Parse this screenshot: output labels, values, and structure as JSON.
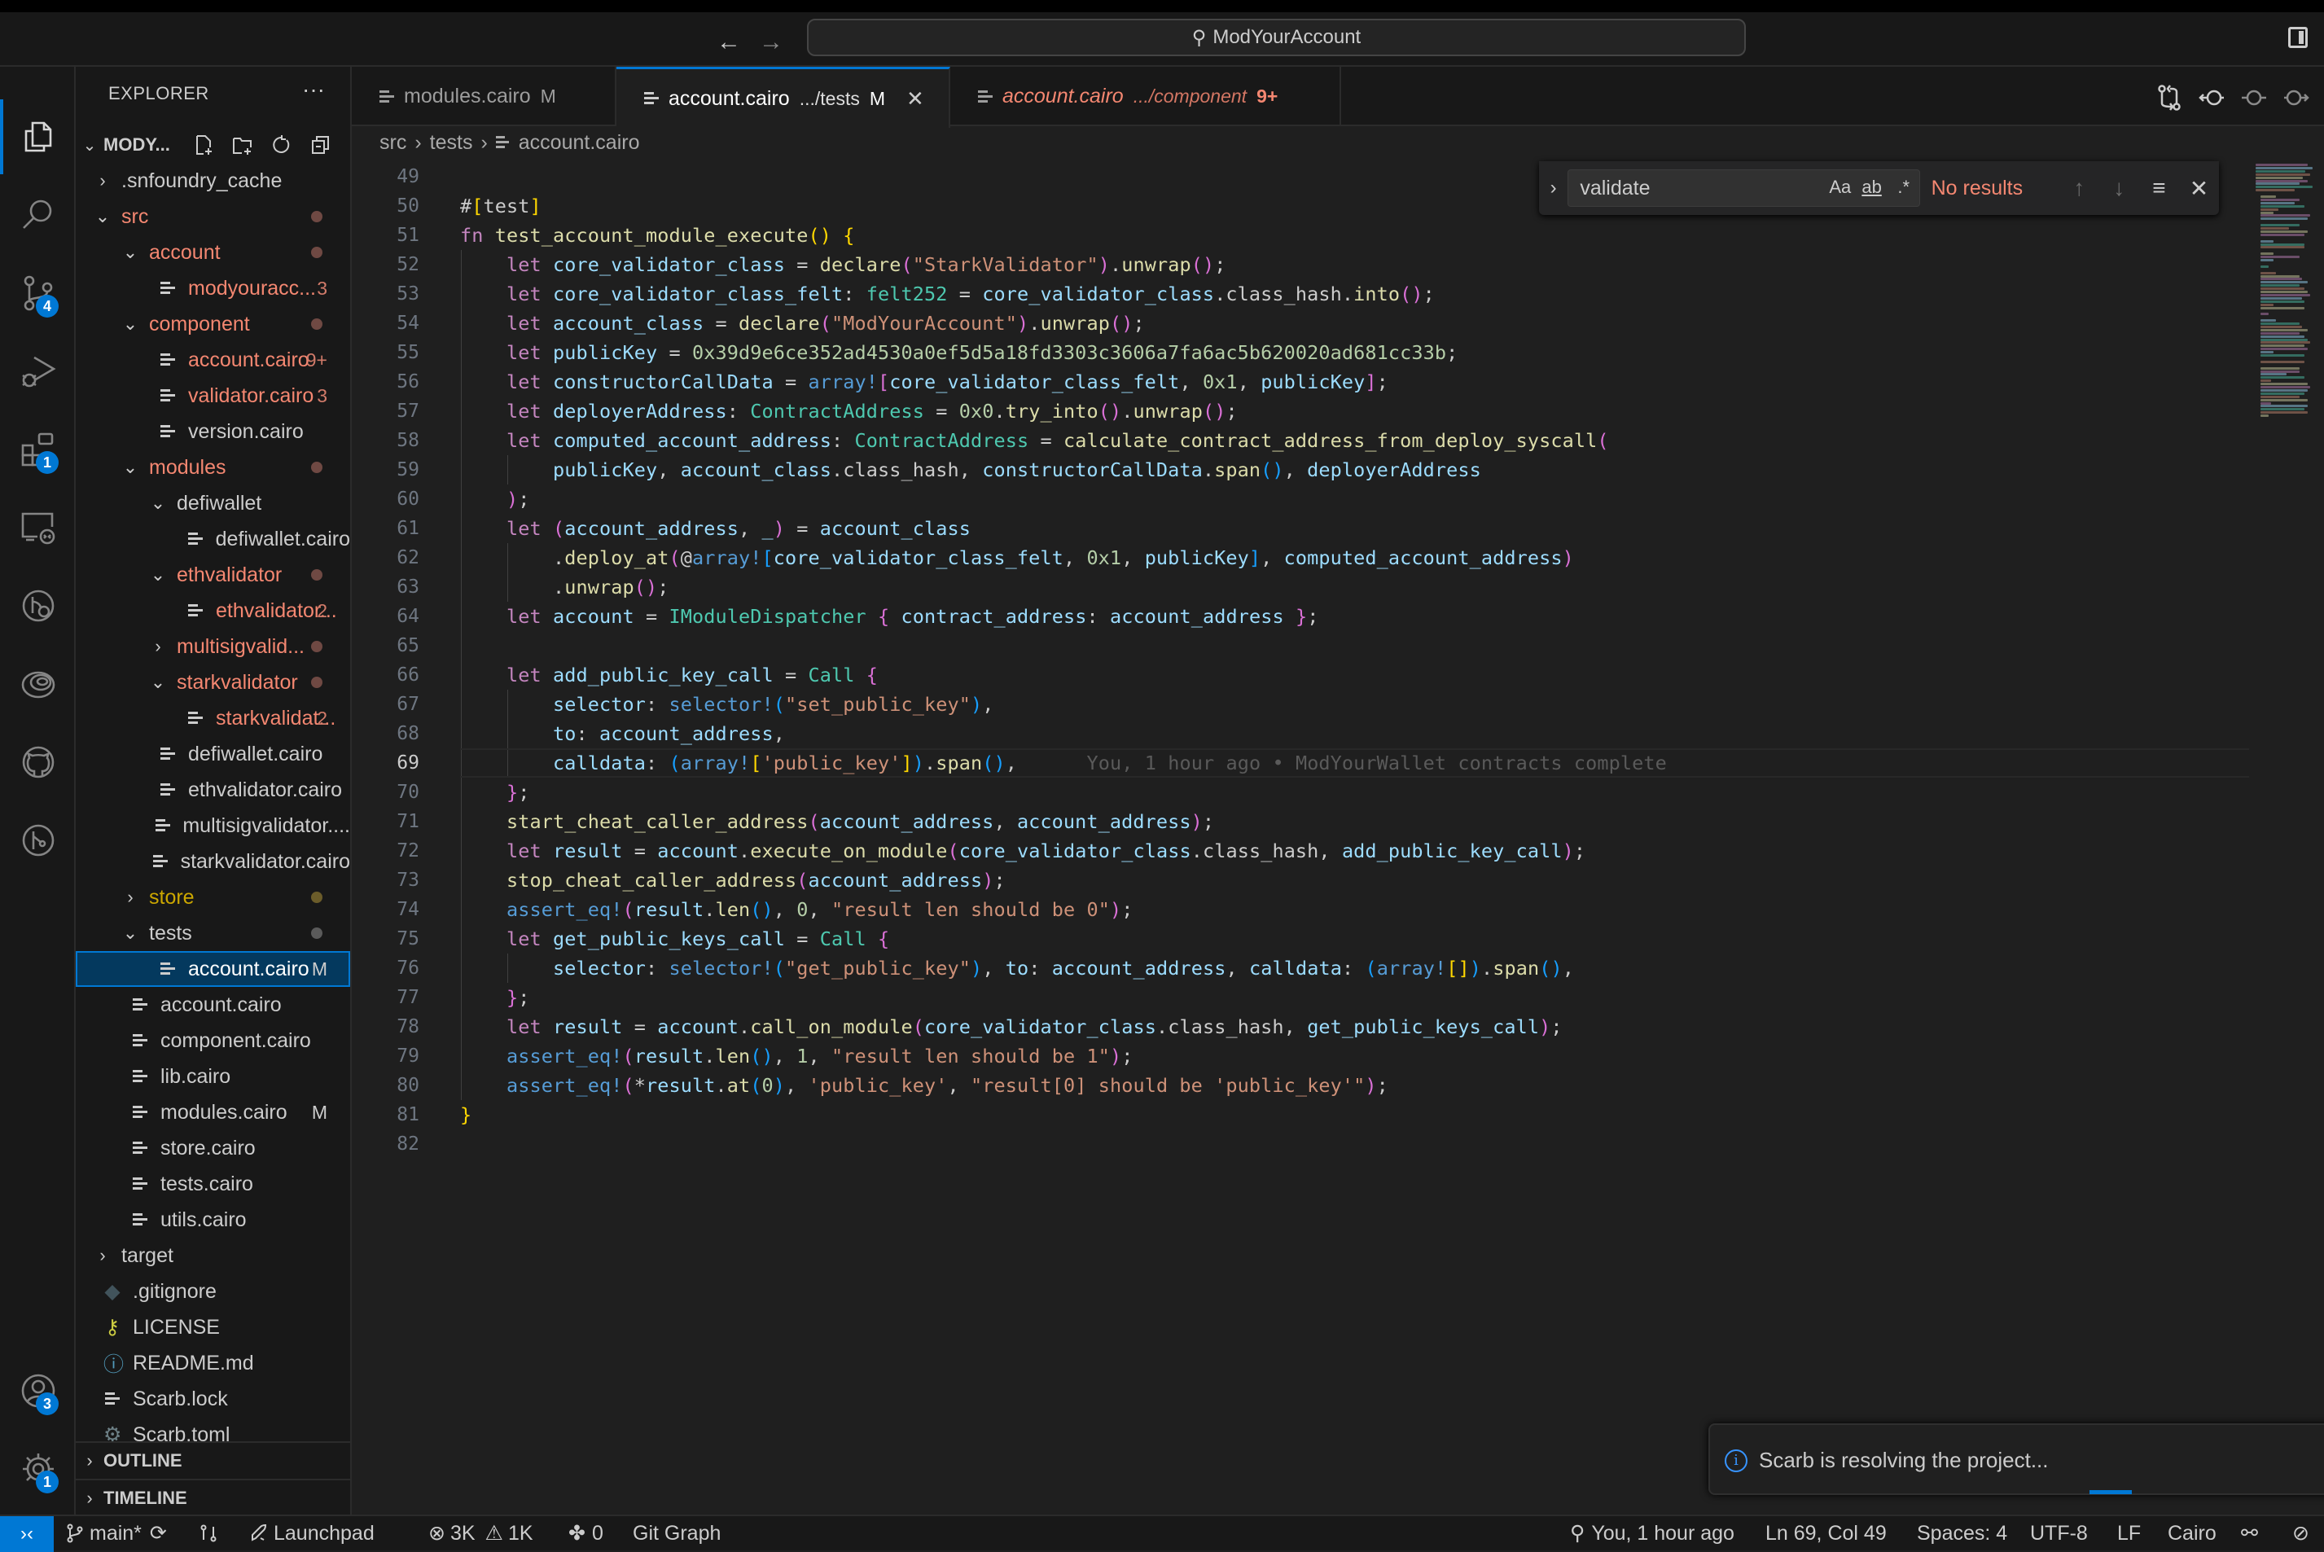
{
  "titlebar": {
    "back_icon": "arrow-left-icon",
    "forward_icon": "arrow-right-icon",
    "command_center": "ModYourAccount",
    "layout_icon": "toggle-secondary-sidebar-icon"
  },
  "activity_bar": {
    "items": [
      {
        "name": "explorer",
        "icon": "files-icon",
        "active": true
      },
      {
        "name": "search",
        "icon": "search-icon"
      },
      {
        "name": "source-control",
        "icon": "source-control-icon",
        "badge": "4"
      },
      {
        "name": "run-debug",
        "icon": "run-debug-icon"
      },
      {
        "name": "extensions",
        "icon": "extensions-icon",
        "badge": "1"
      },
      {
        "name": "remote-explorer",
        "icon": "remote-explorer-icon"
      },
      {
        "name": "gitlens-inspect",
        "icon": "gitlens-inspect-icon"
      },
      {
        "name": "starknet",
        "icon": "spiral-icon"
      },
      {
        "name": "github",
        "icon": "github-icon"
      },
      {
        "name": "git-graph",
        "icon": "git-graph-icon"
      }
    ],
    "accounts_badge": "3",
    "settings_badge": "1"
  },
  "sidebar": {
    "title": "EXPLORER",
    "more": "···",
    "project": "MODY...",
    "tree": [
      {
        "label": ".snfoundry_cache",
        "depth": 0,
        "type": "folder",
        "open": false
      },
      {
        "label": "src",
        "depth": 0,
        "type": "folder",
        "open": true,
        "state": "err",
        "dot": true
      },
      {
        "label": "account",
        "depth": 1,
        "type": "folder",
        "open": true,
        "state": "err",
        "dot": true
      },
      {
        "label": "modyouracc...",
        "depth": 2,
        "type": "file",
        "state": "err",
        "decoration": "3"
      },
      {
        "label": "component",
        "depth": 1,
        "type": "folder",
        "open": true,
        "state": "err",
        "dot": true
      },
      {
        "label": "account.cairo",
        "depth": 2,
        "type": "file",
        "state": "err",
        "decoration": "9+"
      },
      {
        "label": "validator.cairo",
        "depth": 2,
        "type": "file",
        "state": "err",
        "decoration": "3"
      },
      {
        "label": "version.cairo",
        "depth": 2,
        "type": "file"
      },
      {
        "label": "modules",
        "depth": 1,
        "type": "folder",
        "open": true,
        "state": "err",
        "dot": true
      },
      {
        "label": "defiwallet",
        "depth": 2,
        "type": "folder",
        "open": true
      },
      {
        "label": "defiwallet.cairo",
        "depth": 3,
        "type": "file"
      },
      {
        "label": "ethvalidator",
        "depth": 2,
        "type": "folder",
        "open": true,
        "state": "err",
        "dot": true
      },
      {
        "label": "ethvalidator...",
        "depth": 3,
        "type": "file",
        "state": "err",
        "decoration": "2"
      },
      {
        "label": "multisigvalid...",
        "depth": 2,
        "type": "folder",
        "open": false,
        "state": "err",
        "dot": true
      },
      {
        "label": "starkvalidator",
        "depth": 2,
        "type": "folder",
        "open": true,
        "state": "err",
        "dot": true
      },
      {
        "label": "starkvalidat...",
        "depth": 3,
        "type": "file",
        "state": "err",
        "decoration": "2"
      },
      {
        "label": "defiwallet.cairo",
        "depth": 2,
        "type": "file"
      },
      {
        "label": "ethvalidator.cairo",
        "depth": 2,
        "type": "file"
      },
      {
        "label": "multisigvalidator....",
        "depth": 2,
        "type": "file"
      },
      {
        "label": "starkvalidator.cairo",
        "depth": 2,
        "type": "file"
      },
      {
        "label": "store",
        "depth": 1,
        "type": "folder",
        "open": false,
        "state": "warn",
        "dot": true
      },
      {
        "label": "tests",
        "depth": 1,
        "type": "folder",
        "open": true,
        "state": "dim",
        "dot": true
      },
      {
        "label": "account.cairo",
        "depth": 2,
        "type": "file",
        "selected": true,
        "decoration": "M"
      },
      {
        "label": "account.cairo",
        "depth": 1,
        "type": "file"
      },
      {
        "label": "component.cairo",
        "depth": 1,
        "type": "file"
      },
      {
        "label": "lib.cairo",
        "depth": 1,
        "type": "file"
      },
      {
        "label": "modules.cairo",
        "depth": 1,
        "type": "file",
        "decoration": "M"
      },
      {
        "label": "store.cairo",
        "depth": 1,
        "type": "file"
      },
      {
        "label": "tests.cairo",
        "depth": 1,
        "type": "file"
      },
      {
        "label": "utils.cairo",
        "depth": 1,
        "type": "file"
      },
      {
        "label": "target",
        "depth": 0,
        "type": "folder",
        "open": false
      },
      {
        "label": ".gitignore",
        "depth": 0,
        "type": "file",
        "icon": "git-icon"
      },
      {
        "label": "LICENSE",
        "depth": 0,
        "type": "file",
        "icon": "license-key-icon"
      },
      {
        "label": "README.md",
        "depth": 0,
        "type": "file",
        "icon": "info-icon"
      },
      {
        "label": "Scarb.lock",
        "depth": 0,
        "type": "file"
      },
      {
        "label": "Scarb.toml",
        "depth": 0,
        "type": "file",
        "icon": "gear-file-icon"
      }
    ],
    "outline": "OUTLINE",
    "timeline": "TIMELINE"
  },
  "tabs": [
    {
      "label": "modules.cairo",
      "path": "",
      "mark": "M",
      "active": false
    },
    {
      "label": "account.cairo",
      "path": ".../tests",
      "mark": "M",
      "active": true
    },
    {
      "label": "account.cairo",
      "path": ".../component",
      "mark": "9+",
      "active": false,
      "error": true
    }
  ],
  "editor_actions": [
    "open-changes-icon",
    "gitlens-previous-icon",
    "gitlens-commit-icon",
    "gitlens-next-icon"
  ],
  "breadcrumb": [
    "src",
    "tests",
    "account.cairo"
  ],
  "find": {
    "query": "validate",
    "match_case": "Aa",
    "whole_word": "ab",
    "regex": ".*",
    "status": "No results"
  },
  "editor": {
    "current_line": 69,
    "blame": "You, 1 hour ago • ModYourWallet contracts complete",
    "lines": [
      {
        "n": 49,
        "code": ""
      },
      {
        "n": 50,
        "code": "#[test]"
      },
      {
        "n": 51,
        "code": "fn test_account_module_execute() {"
      },
      {
        "n": 52,
        "code": "    let core_validator_class = declare(\"StarkValidator\").unwrap();"
      },
      {
        "n": 53,
        "code": "    let core_validator_class_felt: felt252 = core_validator_class.class_hash.into();"
      },
      {
        "n": 54,
        "code": "    let account_class = declare(\"ModYourAccount\").unwrap();"
      },
      {
        "n": 55,
        "code": "    let publicKey = 0x39d9e6ce352ad4530a0ef5d5a18fd3303c3606a7fa6ac5b620020ad681cc33b;"
      },
      {
        "n": 56,
        "code": "    let constructorCallData = array![core_validator_class_felt, 0x1, publicKey];"
      },
      {
        "n": 57,
        "code": "    let deployerAddress: ContractAddress = 0x0.try_into().unwrap();"
      },
      {
        "n": 58,
        "code": "    let computed_account_address: ContractAddress = calculate_contract_address_from_deploy_syscall("
      },
      {
        "n": 59,
        "code": "        publicKey, account_class.class_hash, constructorCallData.span(), deployerAddress"
      },
      {
        "n": 60,
        "code": "    );"
      },
      {
        "n": 61,
        "code": "    let (account_address, _) = account_class"
      },
      {
        "n": 62,
        "code": "        .deploy_at(@array![core_validator_class_felt, 0x1, publicKey], computed_account_address)"
      },
      {
        "n": 63,
        "code": "        .unwrap();"
      },
      {
        "n": 64,
        "code": "    let account = IModuleDispatcher { contract_address: account_address };"
      },
      {
        "n": 65,
        "code": ""
      },
      {
        "n": 66,
        "code": "    let add_public_key_call = Call {"
      },
      {
        "n": 67,
        "code": "        selector: selector!(\"set_public_key\"),"
      },
      {
        "n": 68,
        "code": "        to: account_address,"
      },
      {
        "n": 69,
        "code": "        calldata: (array!['public_key']).span(),"
      },
      {
        "n": 70,
        "code": "    };"
      },
      {
        "n": 71,
        "code": "    start_cheat_caller_address(account_address, account_address);"
      },
      {
        "n": 72,
        "code": "    let result = account.execute_on_module(core_validator_class.class_hash, add_public_key_call);"
      },
      {
        "n": 73,
        "code": "    stop_cheat_caller_address(account_address);"
      },
      {
        "n": 74,
        "code": "    assert_eq!(result.len(), 0, \"result len should be 0\");"
      },
      {
        "n": 75,
        "code": "    let get_public_keys_call = Call {"
      },
      {
        "n": 76,
        "code": "        selector: selector!(\"get_public_key\"), to: account_address, calldata: (array![]).span(),"
      },
      {
        "n": 77,
        "code": "    };"
      },
      {
        "n": 78,
        "code": "    let result = account.call_on_module(core_validator_class.class_hash, get_public_keys_call);"
      },
      {
        "n": 79,
        "code": "    assert_eq!(result.len(), 1, \"result len should be 1\");"
      },
      {
        "n": 80,
        "code": "    assert_eq!(*result.at(0), 'public_key', \"result[0] should be 'public_key'\");"
      },
      {
        "n": 81,
        "code": "}"
      },
      {
        "n": 82,
        "code": ""
      }
    ]
  },
  "notification": {
    "icon": "info-icon",
    "message": "Scarb is resolving the project..."
  },
  "statusbar": {
    "remote_icon": "remote-icon",
    "branch": "main*",
    "sync_icon": "sync-icon",
    "launchpad": "Launchpad",
    "errors": "3K",
    "warnings": "1K",
    "ports": "0",
    "git_graph": "Git Graph",
    "blame": "You, 1 hour ago",
    "position": "Ln 69, Col 49",
    "spaces": "Spaces: 4",
    "encoding": "UTF-8",
    "eol": "LF",
    "language": "Cairo"
  },
  "colors": {
    "accent": "#0078d4",
    "error": "#f48771",
    "warning": "#cca700"
  }
}
